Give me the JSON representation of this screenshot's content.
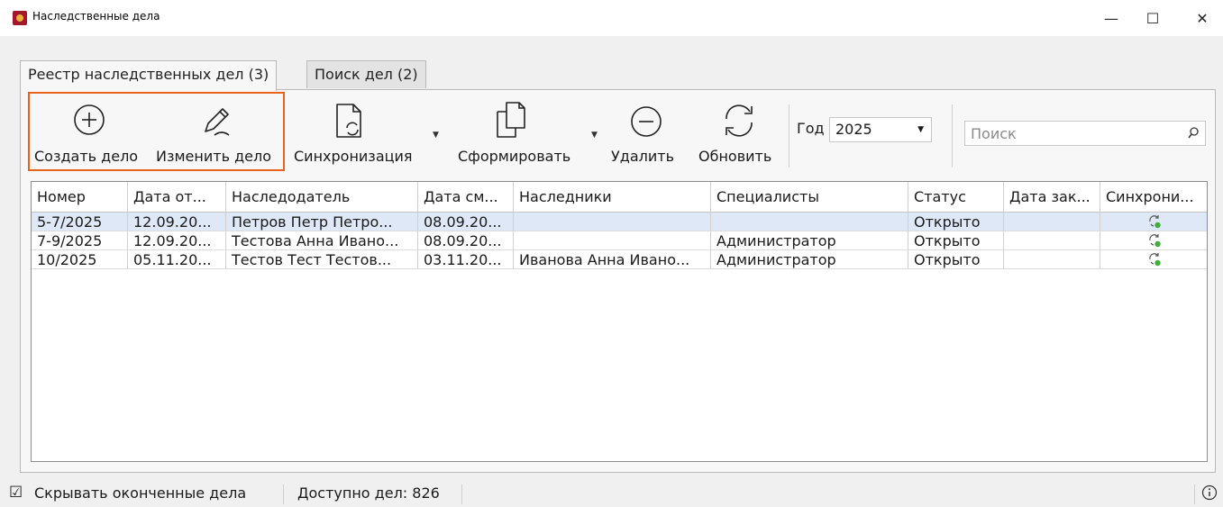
{
  "window": {
    "title": "Наследственные дела",
    "minimize_glyph": "—",
    "maximize_glyph": "☐",
    "close_glyph": "✕"
  },
  "tabs": [
    {
      "label": "Реестр наследственных дел (3)",
      "active": true
    },
    {
      "label": "Поиск дел (2)",
      "active": false
    }
  ],
  "toolbar": {
    "create_label": "Создать дело",
    "edit_label": "Изменить дело",
    "sync_label": "Синхронизация",
    "form_label": "Сформировать",
    "delete_label": "Удалить",
    "refresh_label": "Обновить",
    "year_label": "Год",
    "year_value": "2025",
    "search_placeholder": "Поиск",
    "highlight_color": "#e8641e"
  },
  "grid": {
    "columns": [
      "Номер",
      "Дата от...",
      "Наследодатель",
      "Дата см...",
      "Наследники",
      "Специалисты",
      "Статус",
      "Дата зак...",
      "Синхрони..."
    ],
    "rows": [
      {
        "number": "5-7/2025",
        "date_open": "12.09.20...",
        "testator": "Петров Петр Петро...",
        "date_death": "08.09.20...",
        "heirs": "",
        "specialists": "",
        "status": "Открыто",
        "date_close": "",
        "sync_icon": "sync-ok-icon",
        "selected": true
      },
      {
        "number": "7-9/2025",
        "date_open": "12.09.20...",
        "testator": "Тестова Анна Ивано...",
        "date_death": "08.09.20...",
        "heirs": "",
        "specialists": "Администратор",
        "status": "Открыто",
        "date_close": "",
        "sync_icon": "sync-ok-icon",
        "selected": false
      },
      {
        "number": "10/2025",
        "date_open": "05.11.20...",
        "testator": "Тестов Тест Тестов...",
        "date_death": "03.11.20...",
        "heirs": "Иванова Анна Ивано...",
        "specialists": "Администратор",
        "status": "Открыто",
        "date_close": "",
        "sync_icon": "sync-ok-icon",
        "selected": false
      }
    ]
  },
  "status": {
    "hide_finished_checked": true,
    "hide_finished_label": "Скрывать оконченные дела",
    "available_label": "Доступно дел: 826",
    "info_icon": "info-icon"
  }
}
